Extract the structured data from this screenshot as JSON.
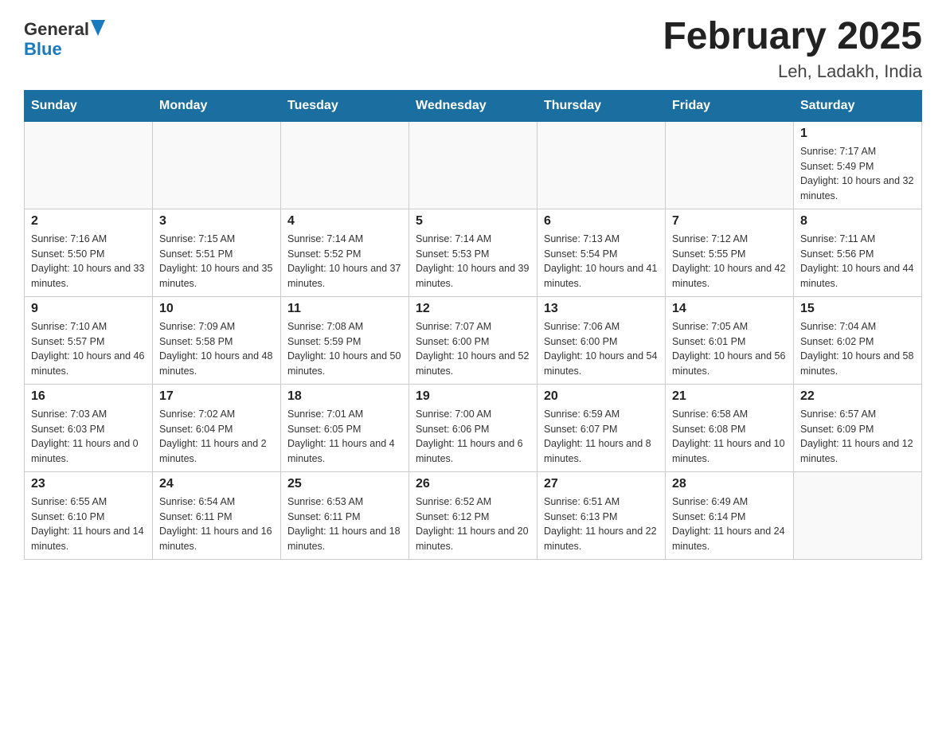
{
  "header": {
    "logo_general": "General",
    "logo_blue": "Blue",
    "month_title": "February 2025",
    "location": "Leh, Ladakh, India"
  },
  "days_of_week": [
    "Sunday",
    "Monday",
    "Tuesday",
    "Wednesday",
    "Thursday",
    "Friday",
    "Saturday"
  ],
  "weeks": [
    [
      {
        "day": "",
        "info": ""
      },
      {
        "day": "",
        "info": ""
      },
      {
        "day": "",
        "info": ""
      },
      {
        "day": "",
        "info": ""
      },
      {
        "day": "",
        "info": ""
      },
      {
        "day": "",
        "info": ""
      },
      {
        "day": "1",
        "info": "Sunrise: 7:17 AM\nSunset: 5:49 PM\nDaylight: 10 hours and 32 minutes."
      }
    ],
    [
      {
        "day": "2",
        "info": "Sunrise: 7:16 AM\nSunset: 5:50 PM\nDaylight: 10 hours and 33 minutes."
      },
      {
        "day": "3",
        "info": "Sunrise: 7:15 AM\nSunset: 5:51 PM\nDaylight: 10 hours and 35 minutes."
      },
      {
        "day": "4",
        "info": "Sunrise: 7:14 AM\nSunset: 5:52 PM\nDaylight: 10 hours and 37 minutes."
      },
      {
        "day": "5",
        "info": "Sunrise: 7:14 AM\nSunset: 5:53 PM\nDaylight: 10 hours and 39 minutes."
      },
      {
        "day": "6",
        "info": "Sunrise: 7:13 AM\nSunset: 5:54 PM\nDaylight: 10 hours and 41 minutes."
      },
      {
        "day": "7",
        "info": "Sunrise: 7:12 AM\nSunset: 5:55 PM\nDaylight: 10 hours and 42 minutes."
      },
      {
        "day": "8",
        "info": "Sunrise: 7:11 AM\nSunset: 5:56 PM\nDaylight: 10 hours and 44 minutes."
      }
    ],
    [
      {
        "day": "9",
        "info": "Sunrise: 7:10 AM\nSunset: 5:57 PM\nDaylight: 10 hours and 46 minutes."
      },
      {
        "day": "10",
        "info": "Sunrise: 7:09 AM\nSunset: 5:58 PM\nDaylight: 10 hours and 48 minutes."
      },
      {
        "day": "11",
        "info": "Sunrise: 7:08 AM\nSunset: 5:59 PM\nDaylight: 10 hours and 50 minutes."
      },
      {
        "day": "12",
        "info": "Sunrise: 7:07 AM\nSunset: 6:00 PM\nDaylight: 10 hours and 52 minutes."
      },
      {
        "day": "13",
        "info": "Sunrise: 7:06 AM\nSunset: 6:00 PM\nDaylight: 10 hours and 54 minutes."
      },
      {
        "day": "14",
        "info": "Sunrise: 7:05 AM\nSunset: 6:01 PM\nDaylight: 10 hours and 56 minutes."
      },
      {
        "day": "15",
        "info": "Sunrise: 7:04 AM\nSunset: 6:02 PM\nDaylight: 10 hours and 58 minutes."
      }
    ],
    [
      {
        "day": "16",
        "info": "Sunrise: 7:03 AM\nSunset: 6:03 PM\nDaylight: 11 hours and 0 minutes."
      },
      {
        "day": "17",
        "info": "Sunrise: 7:02 AM\nSunset: 6:04 PM\nDaylight: 11 hours and 2 minutes."
      },
      {
        "day": "18",
        "info": "Sunrise: 7:01 AM\nSunset: 6:05 PM\nDaylight: 11 hours and 4 minutes."
      },
      {
        "day": "19",
        "info": "Sunrise: 7:00 AM\nSunset: 6:06 PM\nDaylight: 11 hours and 6 minutes."
      },
      {
        "day": "20",
        "info": "Sunrise: 6:59 AM\nSunset: 6:07 PM\nDaylight: 11 hours and 8 minutes."
      },
      {
        "day": "21",
        "info": "Sunrise: 6:58 AM\nSunset: 6:08 PM\nDaylight: 11 hours and 10 minutes."
      },
      {
        "day": "22",
        "info": "Sunrise: 6:57 AM\nSunset: 6:09 PM\nDaylight: 11 hours and 12 minutes."
      }
    ],
    [
      {
        "day": "23",
        "info": "Sunrise: 6:55 AM\nSunset: 6:10 PM\nDaylight: 11 hours and 14 minutes."
      },
      {
        "day": "24",
        "info": "Sunrise: 6:54 AM\nSunset: 6:11 PM\nDaylight: 11 hours and 16 minutes."
      },
      {
        "day": "25",
        "info": "Sunrise: 6:53 AM\nSunset: 6:11 PM\nDaylight: 11 hours and 18 minutes."
      },
      {
        "day": "26",
        "info": "Sunrise: 6:52 AM\nSunset: 6:12 PM\nDaylight: 11 hours and 20 minutes."
      },
      {
        "day": "27",
        "info": "Sunrise: 6:51 AM\nSunset: 6:13 PM\nDaylight: 11 hours and 22 minutes."
      },
      {
        "day": "28",
        "info": "Sunrise: 6:49 AM\nSunset: 6:14 PM\nDaylight: 11 hours and 24 minutes."
      },
      {
        "day": "",
        "info": ""
      }
    ]
  ]
}
